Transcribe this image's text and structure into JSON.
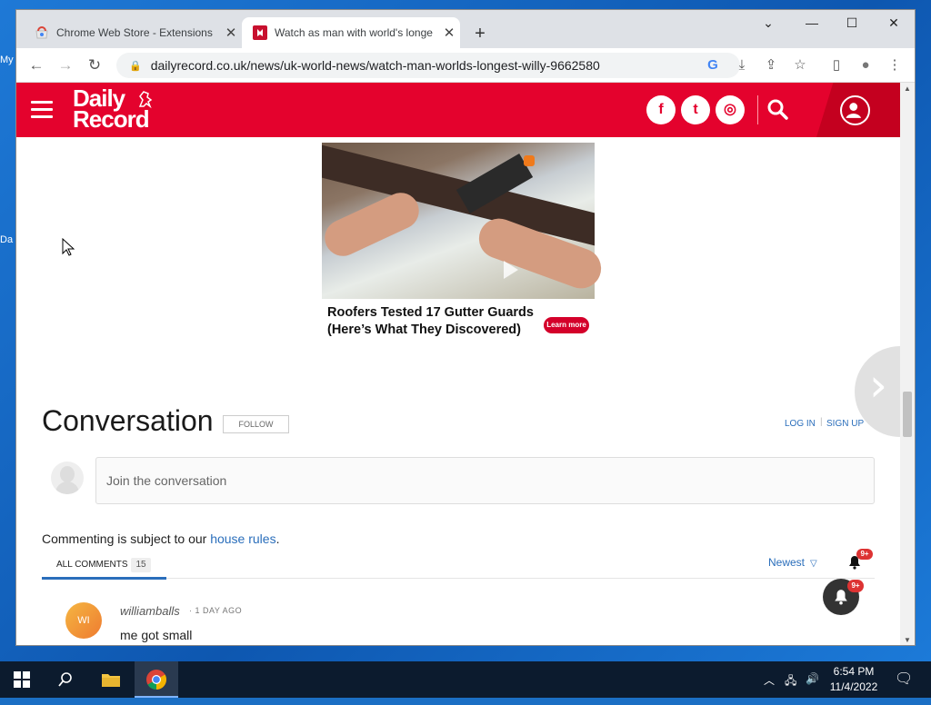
{
  "desktop": {
    "icon1": "My",
    "icon2": "Da"
  },
  "browser": {
    "tabs": [
      {
        "title": "Chrome Web Store - Extensions",
        "close": "✕"
      },
      {
        "title": "Watch as man with world's longe",
        "close": "✕"
      }
    ],
    "newtab": "+",
    "window_controls": {
      "dropdown": "⌄",
      "minimize": "—",
      "maximize": "☐",
      "close": "✕"
    },
    "nav": {
      "back": "←",
      "forward": "→",
      "reload": "↻"
    },
    "url": "dailyrecord.co.uk/news/uk-world-news/watch-man-worlds-longest-willy-9662580",
    "toolbar_icons": [
      "G",
      "⤓",
      "⇪",
      "☆",
      "▯",
      "●",
      "⋮"
    ]
  },
  "site": {
    "logo_line1": "Daily",
    "logo_line2": "Record",
    "social": [
      "f",
      "t",
      "◎"
    ],
    "brand_color": "#e4022d"
  },
  "ad": {
    "caption": "Roofers Tested 17 Gutter Guards (Here’s What They Discovered)",
    "cta": "Learn more"
  },
  "conversation": {
    "title": "Conversation",
    "follow": "FOLLOW",
    "login": "LOG IN",
    "divider": "|",
    "signup": "SIGN UP",
    "placeholder": "Join the conversation",
    "rules_prefix": "Commenting is subject to our ",
    "rules_link": "house rules",
    "rules_suffix": ".",
    "all_comments": "ALL COMMENTS",
    "count": "15",
    "sort": "Newest",
    "notif_badge": "9+",
    "fab_badge": "9+"
  },
  "comments": [
    {
      "initials": "WI",
      "user": "williamballs",
      "time": "· 1 DAY AGO",
      "text": "me got small"
    }
  ],
  "taskbar": {
    "time": "6:54 PM",
    "date": "11/4/2022"
  }
}
